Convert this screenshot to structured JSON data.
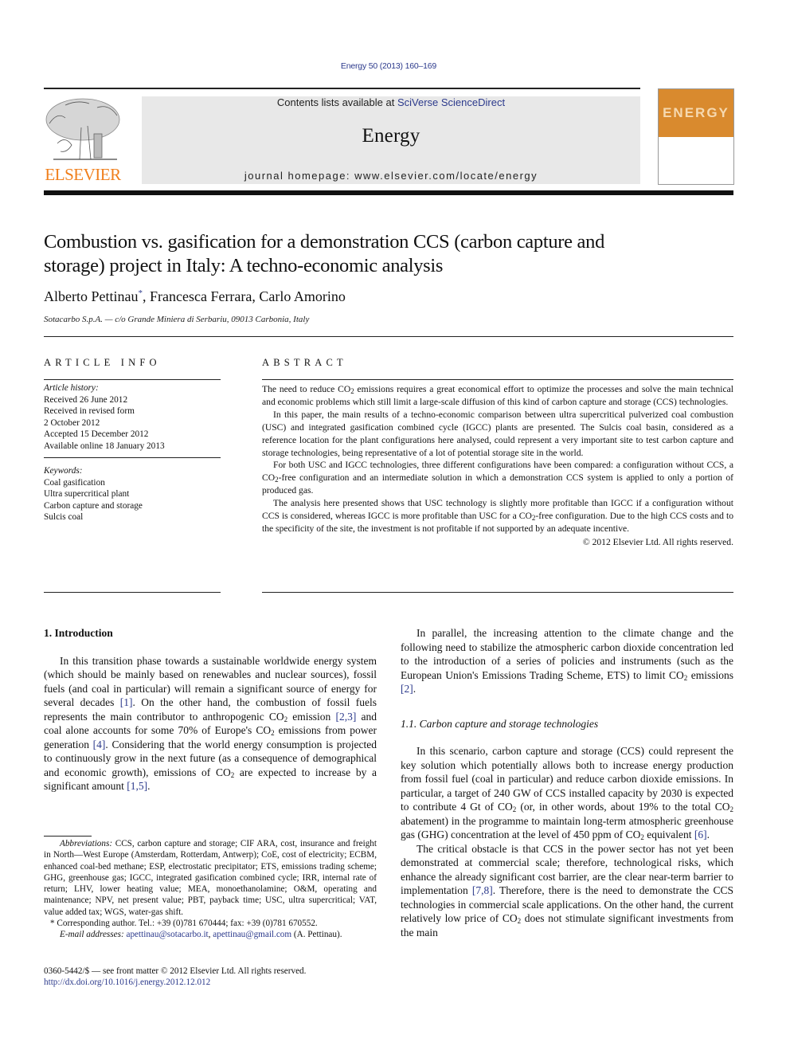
{
  "header": {
    "citation": "Energy 50 (2013) 160–169",
    "contents_prefix": "Contents lists available at ",
    "contents_link": "SciVerse ScienceDirect",
    "journal_name": "Energy",
    "homepage": "journal homepage: www.elsevier.com/locate/energy",
    "publisher_logo": "ELSEVIER",
    "cover_word": "ENERGY",
    "colors": {
      "link": "#2c3a8c",
      "publisher_orange": "#f07f1c",
      "cover_orange": "#d98a2e",
      "banner_bg": "#e8e8e8"
    }
  },
  "article": {
    "title": "Combustion vs. gasification for a demonstration CCS (carbon capture and storage) project in Italy: A techno-economic analysis",
    "authors": "Alberto Pettinau",
    "authors_mark": "*",
    "authors_rest": ", Francesca Ferrara, Carlo Amorino",
    "affiliation": "Sotacarbo S.p.A. — c/o Grande Miniera di Serbariu, 09013 Carbonia, Italy"
  },
  "article_info": {
    "heading": "ARTICLE INFO",
    "history_label": "Article history:",
    "history": [
      "Received 26 June 2012",
      "Received in revised form",
      "2 October 2012",
      "Accepted 15 December 2012",
      "Available online 18 January 2013"
    ],
    "keywords_label": "Keywords:",
    "keywords": [
      "Coal gasification",
      "Ultra supercritical plant",
      "Carbon capture and storage",
      "Sulcis coal"
    ]
  },
  "abstract": {
    "heading": "ABSTRACT",
    "p1a": "The need to reduce CO",
    "p1b": " emissions requires a great economical effort to optimize the processes and solve the main technical and economic problems which still limit a large-scale diffusion of this kind of carbon capture and storage (CCS) technologies.",
    "p2": "In this paper, the main results of a techno-economic comparison between ultra supercritical pulverized coal combustion (USC) and integrated gasification combined cycle (IGCC) plants are presented. The Sulcis coal basin, considered as a reference location for the plant configurations here analysed, could represent a very important site to test carbon capture and storage technologies, being representative of a lot of potential storage site in the world.",
    "p3a": "For both USC and IGCC technologies, three different configurations have been compared: a configuration without CCS, a CO",
    "p3b": "-free configuration and an intermediate solution in which a demonstration CCS system is applied to only a portion of produced gas.",
    "p4a": "The analysis here presented shows that USC technology is slightly more profitable than IGCC if a configuration without CCS is considered, whereas IGCC is more profitable than USC for a CO",
    "p4b": "-free configuration. Due to the high CCS costs and to the specificity of the site, the investment is not profitable if not supported by an adequate incentive.",
    "copyright": "© 2012 Elsevier Ltd. All rights reserved.",
    "sub2": "2"
  },
  "body": {
    "section1_heading": "1.  Introduction",
    "intro_p1": [
      "In this transition phase towards a sustainable worldwide energy system (which should be mainly based on renewables and nuclear sources), fossil fuels (and coal in particular) will remain a significant source of energy for several decades ",
      "[1]",
      ". On the other hand, the combustion of fossil fuels represents the main contributor to anthropogenic CO",
      " emission ",
      "[2,3]",
      " and coal alone accounts for some 70% of Europe's CO",
      " emissions from power generation ",
      "[4]",
      ". Considering that the world energy consumption is projected to continuously grow in the next future (as a consequence of demographical and economic growth), emissions of CO",
      " are expected to increase by a significant amount ",
      "[1,5]",
      "."
    ],
    "intro_p2": [
      "In parallel, the increasing attention to the climate change and the following need to stabilize the atmospheric carbon dioxide concentration led to the introduction of a series of policies and instruments (such as the European Union's Emissions Trading Scheme, ETS) to limit CO",
      " emissions ",
      "[2]",
      "."
    ],
    "subsection_heading": "1.1.  Carbon capture and storage technologies",
    "ccs_p1": [
      "In this scenario, carbon capture and storage (CCS) could represent the key solution which potentially allows both to increase energy production from fossil fuel (coal in particular) and reduce carbon dioxide emissions. In particular, a target of 240 GW of CCS installed capacity by 2030 is expected to contribute 4 Gt of CO",
      " (or, in other words, about 19% to the total CO",
      " abatement) in the programme to maintain long-term atmospheric greenhouse gas (GHG) concentration at the level of 450 ppm of CO",
      " equivalent ",
      "[6]",
      "."
    ],
    "ccs_p2": [
      "The critical obstacle is that CCS in the power sector has not yet been demonstrated at commercial scale; therefore, technological risks, which enhance the already significant cost barrier, are the clear near-term barrier to implementation ",
      "[7,8]",
      ". Therefore, there is the need to demonstrate the CCS technologies in commercial scale applications. On the other hand, the current relatively low price of CO",
      " does not stimulate significant investments from the main"
    ]
  },
  "footnotes": {
    "abbrev_label": "Abbreviations:",
    "abbrev_text": " CCS, carbon capture and storage; CIF ARA, cost, insurance and freight in North—West Europe (Amsterdam, Rotterdam, Antwerp); CoE, cost of electricity; ECBM, enhanced coal-bed methane; ESP, electrostatic precipitator; ETS, emissions trading scheme; GHG, greenhouse gas; IGCC, integrated gasification combined cycle; IRR, internal rate of return; LHV, lower heating value; MEA, monoethanolamine; O&M, operating and maintenance; NPV, net present value; PBT, payback time; USC, ultra supercritical; VAT, value added tax; WGS, water-gas shift.",
    "corresponding": "* Corresponding author. Tel.: +39 (0)781 670444; fax: +39 (0)781 670552.",
    "email_label": "E-mail addresses:",
    "email1": "apettinau@sotacarbo.it",
    "email2": "apettinau@gmail.com",
    "email_suffix": " (A. Pettinau)."
  },
  "front_matter": {
    "issn_line": "0360-5442/$ — see front matter © 2012 Elsevier Ltd. All rights reserved.",
    "doi": "http://dx.doi.org/10.1016/j.energy.2012.12.012"
  }
}
